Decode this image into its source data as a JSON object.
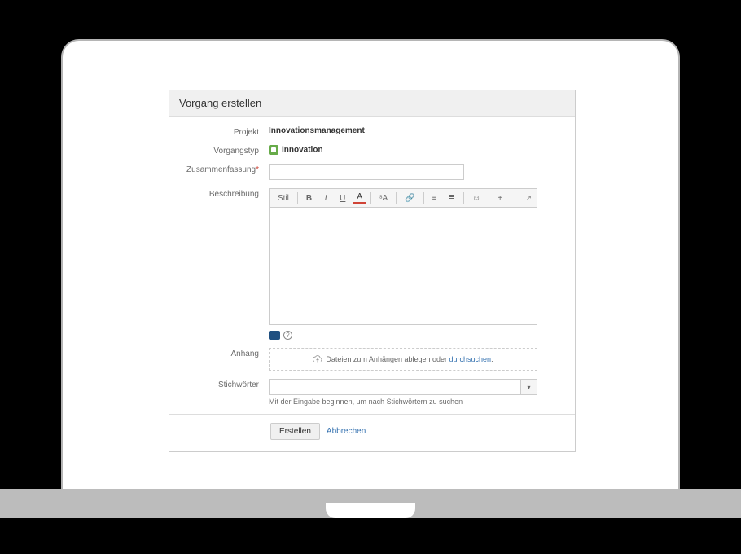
{
  "dialog": {
    "title": "Vorgang erstellen",
    "fields": {
      "project": {
        "label": "Projekt",
        "value": "Innovationsmanagement"
      },
      "issueType": {
        "label": "Vorgangstyp",
        "value": "Innovation"
      },
      "summary": {
        "label": "Zusammenfassung",
        "required": "*",
        "value": ""
      },
      "description": {
        "label": "Beschreibung",
        "value": ""
      },
      "attachment": {
        "label": "Anhang",
        "dropText": "Dateien zum Anhängen ablegen oder ",
        "browseLink": "durchsuchen"
      },
      "tags": {
        "label": "Stichwörter",
        "hint": "Mit der Eingabe beginnen, um nach Stichwörtern zu suchen"
      }
    },
    "toolbar": {
      "style": "Stil",
      "bold": "B",
      "italic": "I",
      "underline": "U",
      "color": "A",
      "clear": "ˢA",
      "link": "🔗",
      "listUl": "≡",
      "listOl": "≣",
      "emoji": "☺",
      "more": "+",
      "expand": "↗"
    },
    "footer": {
      "submit": "Erstellen",
      "cancel": "Abbrechen"
    },
    "helpIcon": "?"
  }
}
